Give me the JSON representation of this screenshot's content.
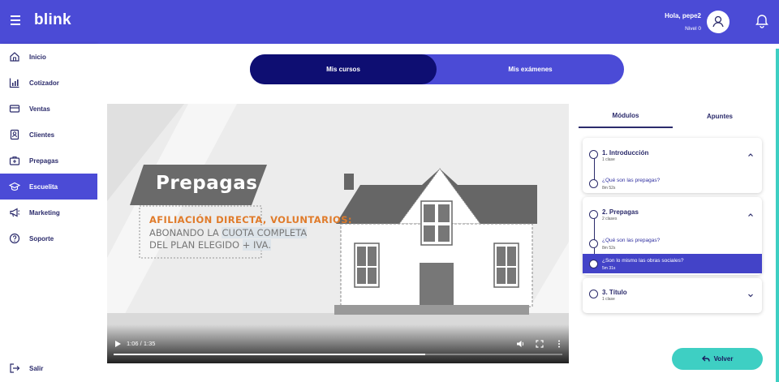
{
  "header": {
    "logo": "blink",
    "greeting": "Hola, pepe2",
    "level": "Nivel 0",
    "menu_icon": "hamburger-icon",
    "avatar_icon": "user-icon",
    "notification_icon": "bell-icon"
  },
  "sidebar": {
    "items": [
      {
        "label": "Inicio",
        "icon": "home-icon"
      },
      {
        "label": "Cotizador",
        "icon": "chart-icon"
      },
      {
        "label": "Ventas",
        "icon": "card-icon"
      },
      {
        "label": "Clientes",
        "icon": "contact-icon"
      },
      {
        "label": "Prepagas",
        "icon": "medical-case-icon"
      },
      {
        "label": "Escuelita",
        "icon": "graduation-cap-icon",
        "active": true
      },
      {
        "label": "Marketing",
        "icon": "megaphone-icon"
      },
      {
        "label": "Soporte",
        "icon": "help-icon"
      }
    ],
    "logout": {
      "label": "Salir",
      "icon": "logout-icon"
    }
  },
  "tabs": {
    "courses": "Mis cursos",
    "exams": "Mis exámenes",
    "active": "courses"
  },
  "video": {
    "slide_title": "Prepagas",
    "headline": "AFILIACIÓN DIRECTA, VOLUNTARIOS:",
    "line1_a": "ABONANDO LA ",
    "line1_b": "CUOTA COMPLETA",
    "line2_a": "DEL PLAN ELEGIDO ",
    "line2_b": "+ IVA.",
    "time": "1:06 / 1:35",
    "progress": 0.695,
    "colors": {
      "accent": "#e07b2a",
      "banner": "#6a6a6a",
      "house": "#666666"
    }
  },
  "panel": {
    "tabs": {
      "modules": "Módulos",
      "notes": "Apuntes",
      "active": "modules"
    },
    "modules": [
      {
        "title": "1. Introducción",
        "count": "1 clase",
        "expanded": true,
        "lessons": [
          {
            "title": "¿Qué son las prepagas?",
            "duration": "8m 52s"
          }
        ]
      },
      {
        "title": "2. Prepagas",
        "count": "2 clases",
        "expanded": true,
        "lessons": [
          {
            "title": "¿Qué son las prepagas?",
            "duration": "8m 52s"
          },
          {
            "title": "¿Son lo mismo las obras sociales?",
            "duration": "5m 31s",
            "active": true
          }
        ]
      },
      {
        "title": "3. Título",
        "count": "1 clase",
        "expanded": false,
        "lessons": []
      }
    ]
  },
  "back_button": {
    "label": "Volver",
    "icon": "back-arrow-icon"
  },
  "colors": {
    "primary": "#4b4bd6",
    "dark": "#0e0e72",
    "accent": "#3ecfc3",
    "text": "#2b2b6b"
  }
}
